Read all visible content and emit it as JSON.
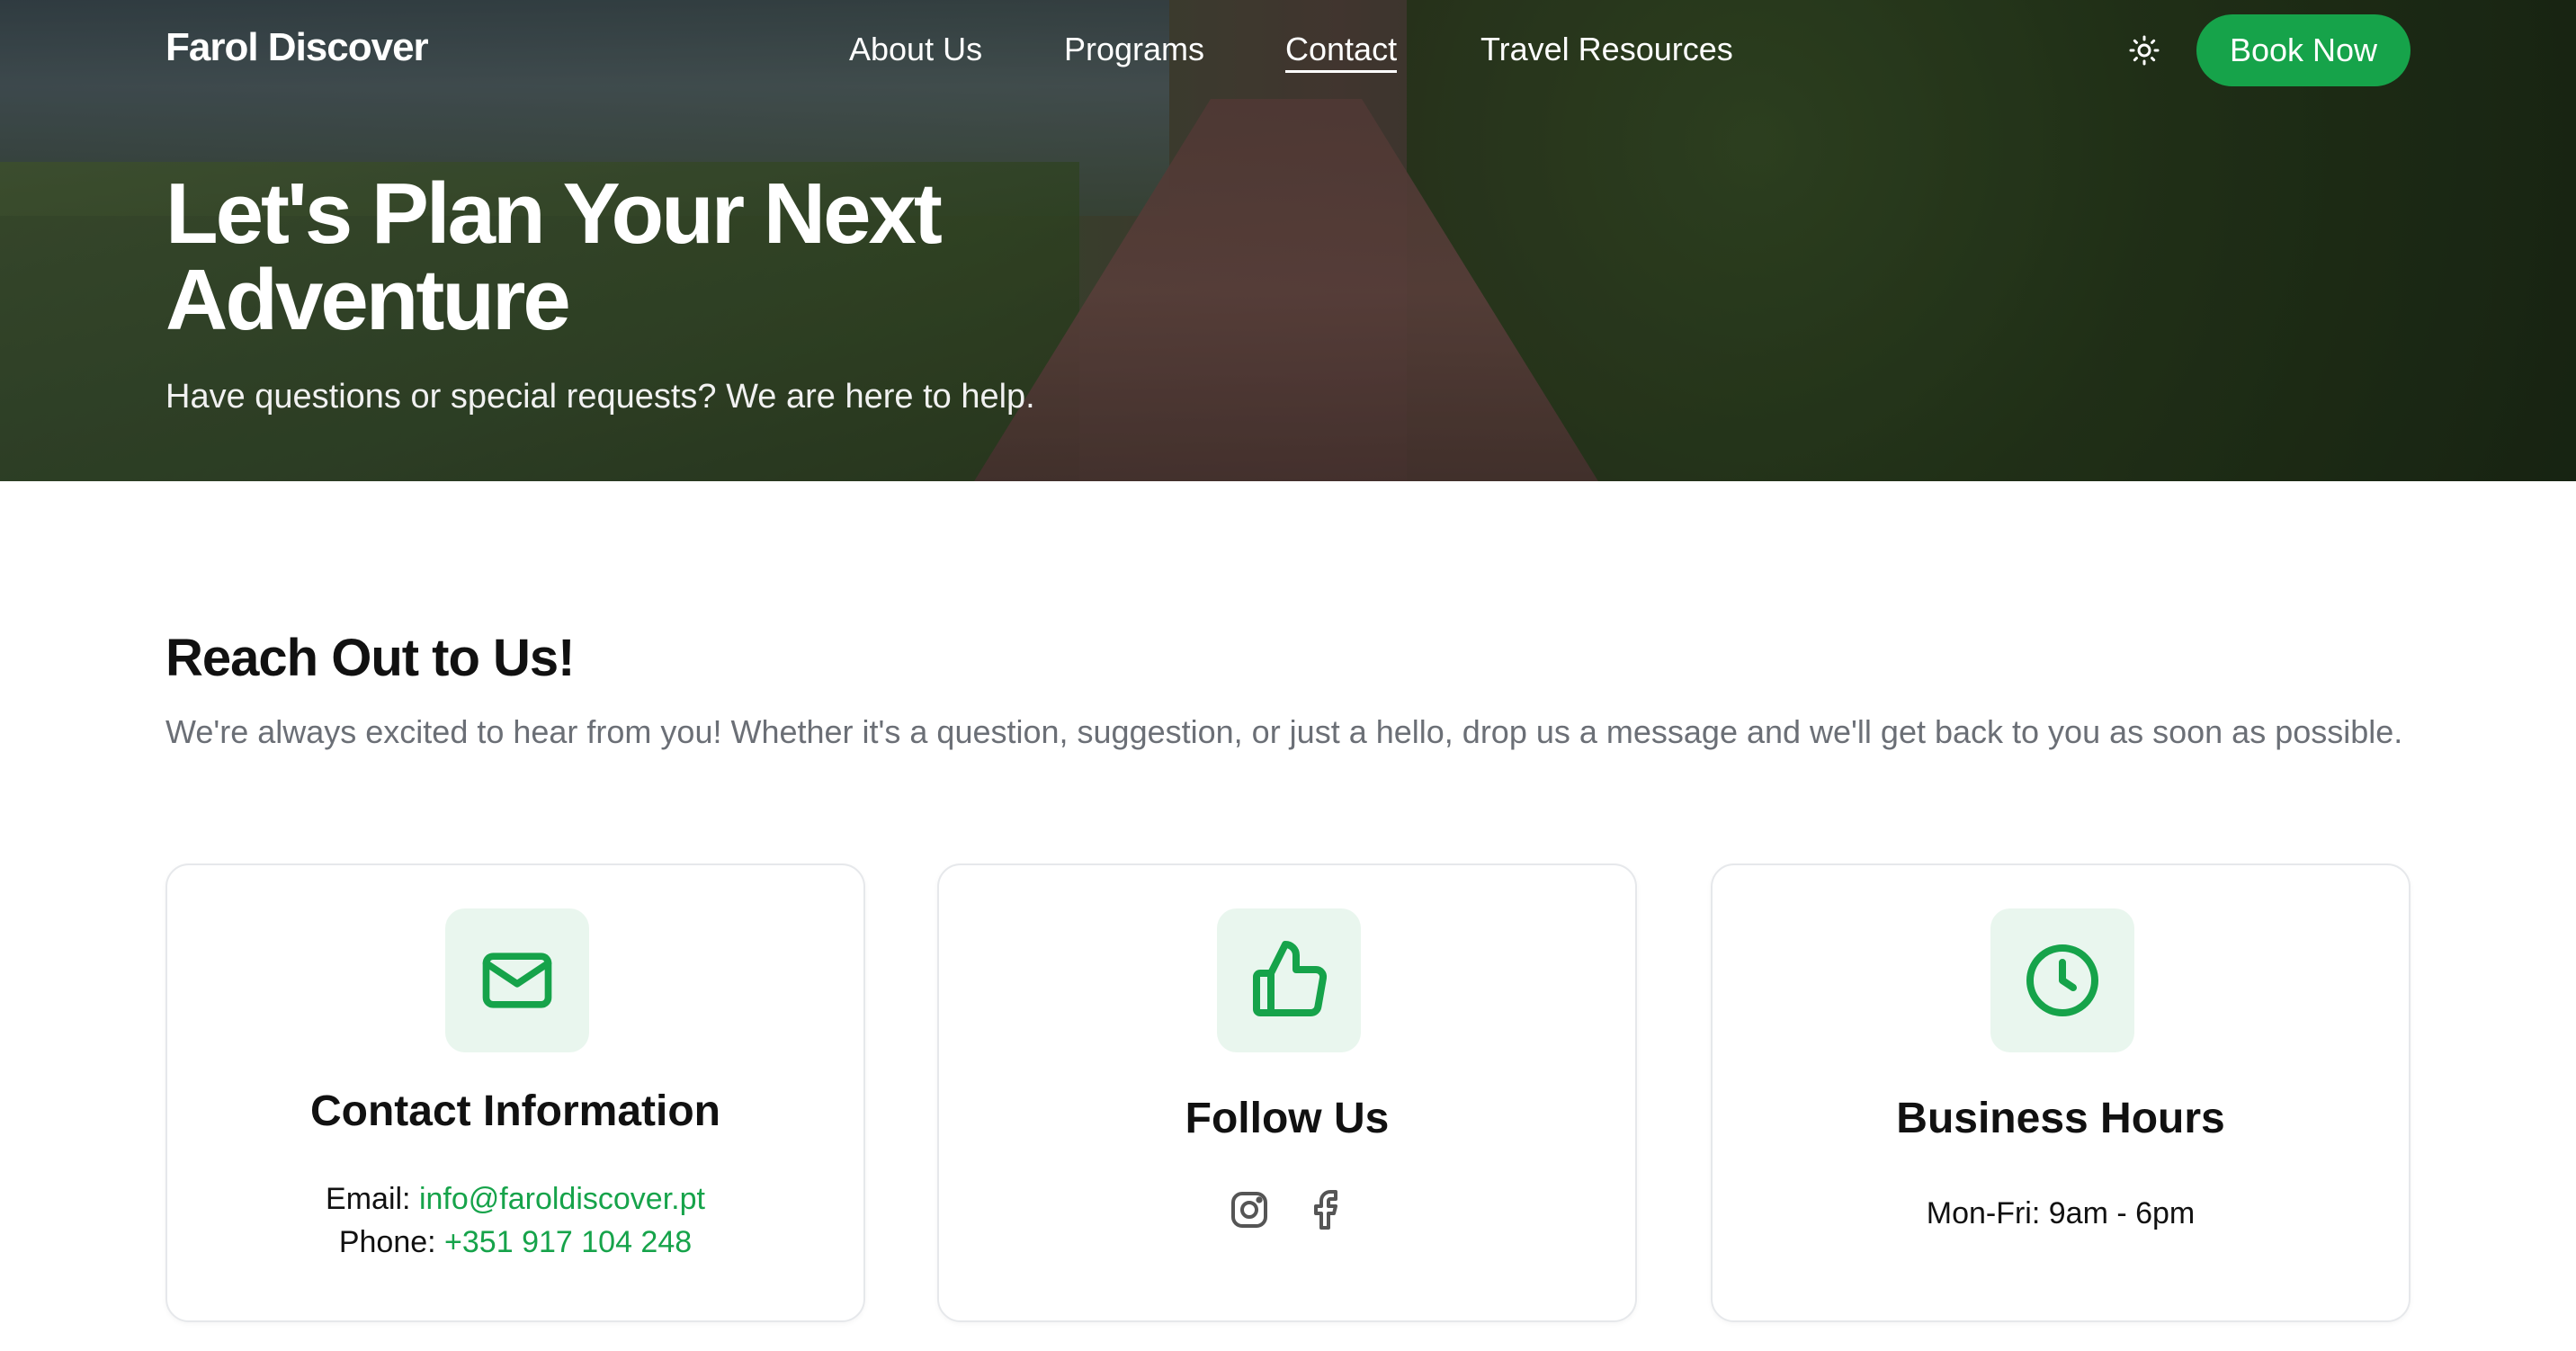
{
  "nav": {
    "brand": "Farol Discover",
    "links": [
      "About Us",
      "Programs",
      "Contact",
      "Travel Resources"
    ],
    "active_link": "Contact",
    "book_label": "Book Now"
  },
  "hero": {
    "title_line1": "Let's Plan Your Next",
    "title_line2": "Adventure",
    "subtitle": "Have questions or special requests? We are here to help."
  },
  "intro": {
    "title": "Reach Out to Us!",
    "text": "We're always excited to hear from you! Whether it's a question, suggestion, or just a hello, drop us a message and we'll get back to you as soon as possible."
  },
  "cards": {
    "contact": {
      "title": "Contact Information",
      "email_label": "Email:",
      "email_value": "info@faroldiscover.pt",
      "phone_label": "Phone:",
      "phone_value": "+351 917 104 248",
      "icon": "mail-icon"
    },
    "follow": {
      "title": "Follow Us",
      "icon": "thumbs-up-icon",
      "socials": [
        "instagram-icon",
        "facebook-icon"
      ]
    },
    "hours": {
      "title": "Business Hours",
      "line": "Mon-Fri: 9am - 6pm",
      "icon": "clock-icon"
    }
  },
  "colors": {
    "accent": "#16a34a",
    "icon_bg": "#e9f6ee",
    "muted_text": "#6b6f76"
  }
}
